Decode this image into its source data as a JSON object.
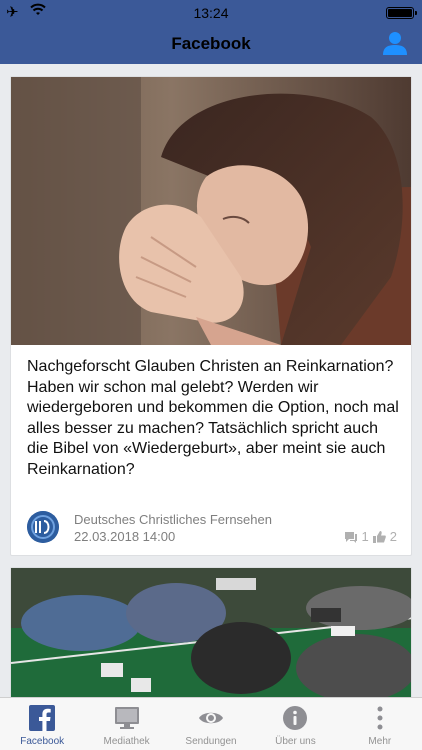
{
  "status_bar": {
    "time": "13:24"
  },
  "nav": {
    "title": "Facebook"
  },
  "posts": [
    {
      "text": "Nachgeforscht Glauben Christen an Reinkarnation? Haben wir schon mal gelebt? Werden wir wiedergeboren und bekommen die Option, noch mal alles besser zu machen? Tatsächlich spricht auch die Bibel von «Wiedergeburt», aber meint sie auch Reinkarnation?",
      "source": "Deutsches Christliches Fernsehen",
      "date": "22.03.2018 14:00",
      "comments": "1",
      "likes": "2"
    }
  ],
  "tabs": [
    {
      "label": "Facebook",
      "icon": "facebook-icon",
      "active": true
    },
    {
      "label": "Mediathek",
      "icon": "monitor-icon"
    },
    {
      "label": "Sendungen",
      "icon": "eye-icon"
    },
    {
      "label": "Über uns",
      "icon": "info-icon"
    },
    {
      "label": "Mehr",
      "icon": "more-icon"
    }
  ],
  "colors": {
    "brand": "#3b5998",
    "muted": "#7f7f7f"
  }
}
